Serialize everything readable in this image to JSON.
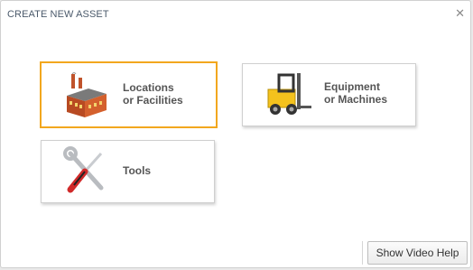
{
  "dialog": {
    "title": "CREATE NEW ASSET",
    "close_icon": "close-icon"
  },
  "cards": [
    {
      "line1": "Locations",
      "line2": "or Facilities",
      "icon": "factory-icon",
      "selected": true
    },
    {
      "line1": "Equipment",
      "line2": "or Machines",
      "icon": "forklift-icon",
      "selected": false
    },
    {
      "line1": "Tools",
      "line2": "",
      "icon": "tools-icon",
      "selected": false
    }
  ],
  "footer": {
    "help_label": "Show Video Help"
  },
  "colors": {
    "selected_border": "#f2a71e",
    "title_text": "#4b5a6b"
  }
}
